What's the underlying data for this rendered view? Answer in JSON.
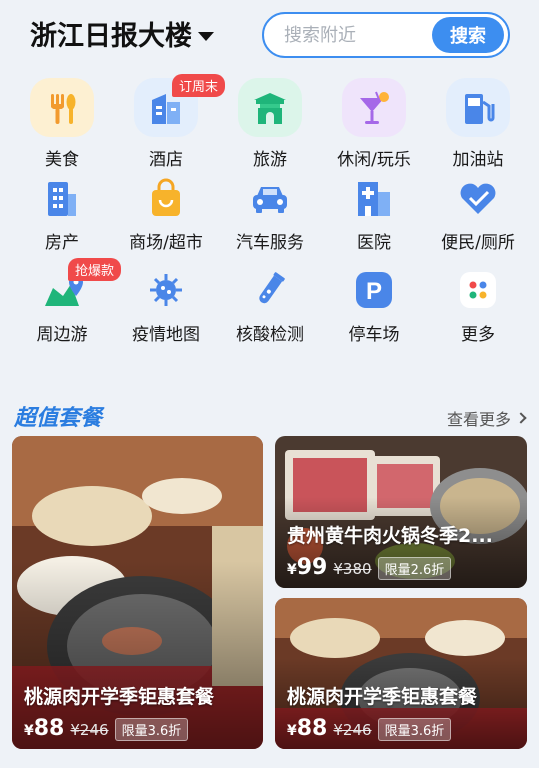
{
  "header": {
    "location": "浙江日报大楼",
    "search_placeholder": "搜索附近",
    "search_button": "搜索"
  },
  "categories": [
    {
      "label": "美食",
      "icon": "food-icon"
    },
    {
      "label": "酒店",
      "icon": "hotel-icon",
      "badge": "订周末"
    },
    {
      "label": "旅游",
      "icon": "travel-icon"
    },
    {
      "label": "休闲/玩乐",
      "icon": "cocktail-icon"
    },
    {
      "label": "加油站",
      "icon": "gas-station-icon"
    },
    {
      "label": "房产",
      "icon": "building-icon"
    },
    {
      "label": "商场/超市",
      "icon": "shopping-bag-icon"
    },
    {
      "label": "汽车服务",
      "icon": "car-icon"
    },
    {
      "label": "医院",
      "icon": "hospital-icon"
    },
    {
      "label": "便民/厕所",
      "icon": "handshake-icon"
    },
    {
      "label": "周边游",
      "icon": "location-icon",
      "badge": "抢爆款"
    },
    {
      "label": "疫情地图",
      "icon": "virus-icon"
    },
    {
      "label": "核酸检测",
      "icon": "test-tube-icon"
    },
    {
      "label": "停车场",
      "icon": "parking-icon"
    },
    {
      "label": "更多",
      "icon": "more-icon"
    }
  ],
  "section": {
    "title": "超值套餐",
    "more": "查看更多"
  },
  "deals": [
    {
      "title": "桃源肉开学季钜惠套餐",
      "price": "88",
      "original": "¥246",
      "tag": "限量3.6折"
    },
    {
      "title": "贵州黄牛肉火锅冬季2...",
      "price": "99",
      "original": "¥380",
      "tag": "限量2.6折"
    },
    {
      "title": "桃源肉开学季钜惠套餐",
      "price": "88",
      "original": "¥246",
      "tag": "限量3.6折"
    }
  ],
  "colors": {
    "accent": "#3d8ef0",
    "badge": "#f04a4a",
    "section_title": "#2b7de0"
  }
}
